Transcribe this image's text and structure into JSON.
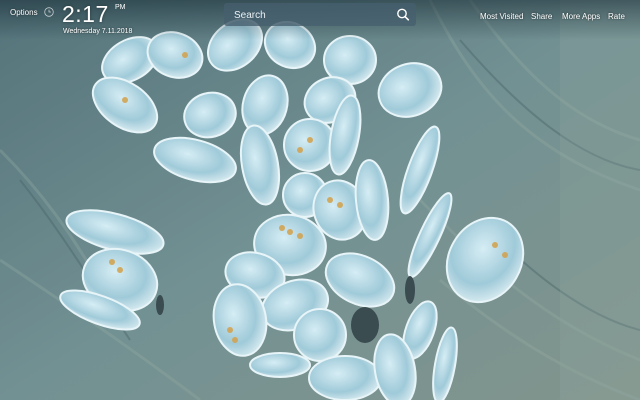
{
  "header": {
    "options_label": "Options",
    "time": "2:17",
    "ampm": "PM",
    "date": "Wednesday 7.11.2018"
  },
  "search": {
    "placeholder": "Search"
  },
  "nav": {
    "most_visited": "Most Visited",
    "share": "Share",
    "more_apps": "More Apps",
    "rate": "Rate"
  },
  "colors": {
    "wallpaper_base": "#5f7d84",
    "butterfly_wing": "#a9d3e2",
    "search_bg": "#465f6e"
  }
}
